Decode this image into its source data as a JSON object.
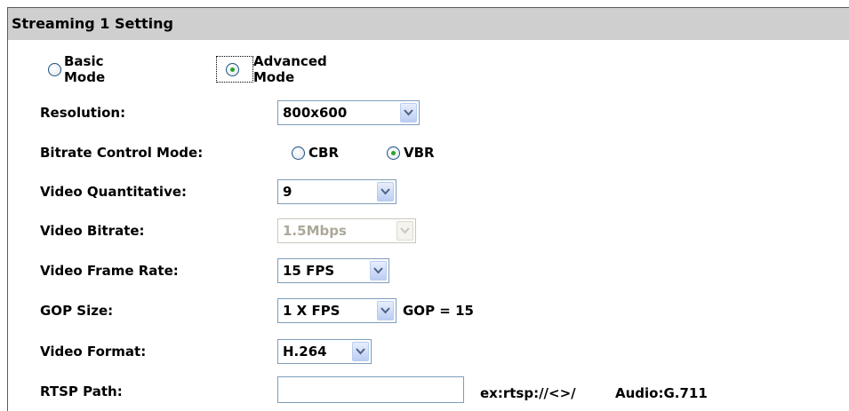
{
  "header": {
    "title": "Streaming 1 Setting"
  },
  "mode": {
    "basic_label": "Basic Mode",
    "advanced_label": "Advanced Mode",
    "selected": "advanced"
  },
  "fields": {
    "resolution": {
      "label": "Resolution:",
      "value": "800x600"
    },
    "bitrate_mode": {
      "label": "Bitrate Control Mode:",
      "cbr_label": "CBR",
      "vbr_label": "VBR",
      "selected": "VBR"
    },
    "quantitative": {
      "label": "Video Quantitative:",
      "value": "9"
    },
    "bitrate": {
      "label": "Video Bitrate:",
      "value": "1.5Mbps",
      "disabled": true
    },
    "frame_rate": {
      "label": "Video Frame Rate:",
      "value": "15 FPS"
    },
    "gop": {
      "label": "GOP Size:",
      "value": "1 X FPS",
      "note": "GOP = 15"
    },
    "format": {
      "label": "Video Format:",
      "value": "H.264"
    },
    "rtsp": {
      "label": "RTSP Path:",
      "value": "",
      "hint": "ex:rtsp://<>/",
      "audio": "Audio:G.711"
    }
  },
  "colors": {
    "header_bg": "#cfcfcf",
    "radio_dot": "#27a427",
    "border": "#7f9db9"
  }
}
